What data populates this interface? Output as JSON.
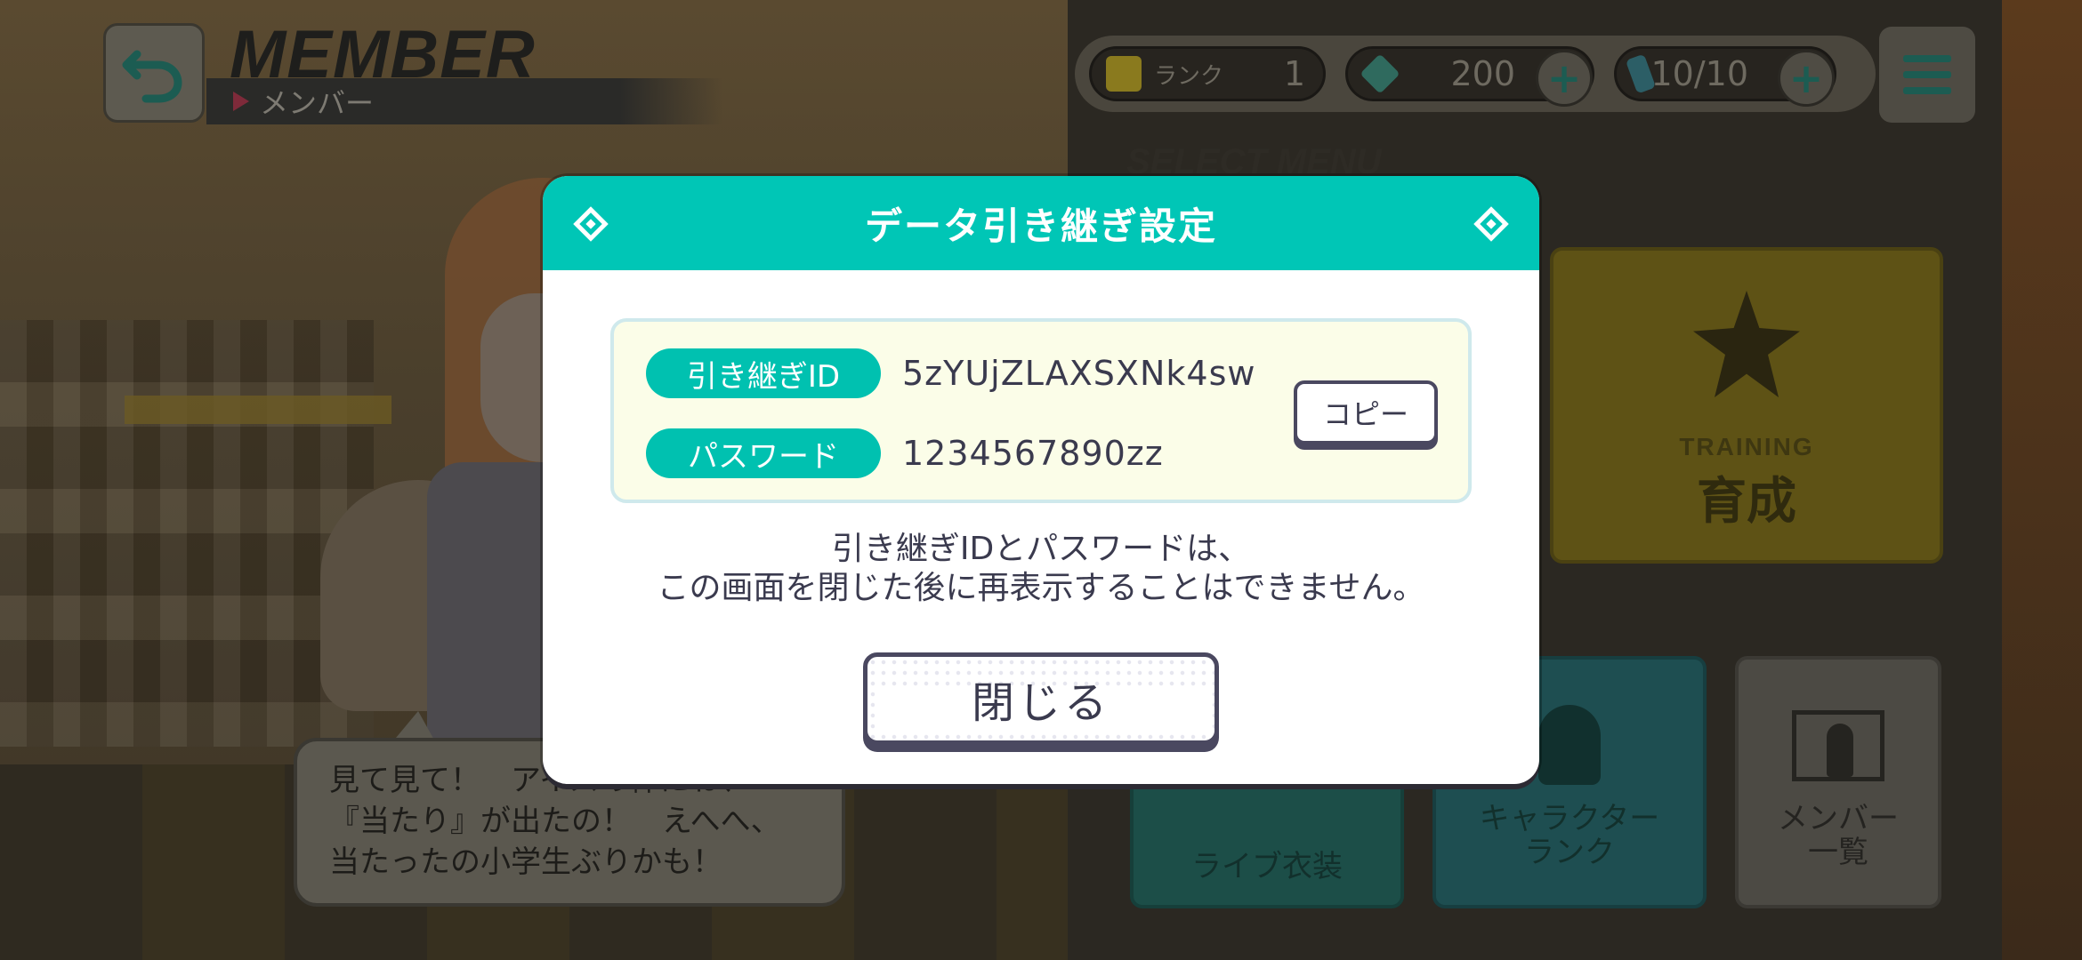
{
  "header": {
    "title": "MEMBER",
    "subtitle": "メンバー"
  },
  "status": {
    "rank_label": "ランク",
    "rank_value": "1",
    "gems": "200",
    "tickets": "10/10"
  },
  "section_label": "SELECT MENU",
  "menu_cards": {
    "training_en": "TRAINING",
    "training_jp": "育成",
    "costume": "ライブ衣装",
    "character_rank_line1": "キャラクター",
    "character_rank_line2": "ランク",
    "member_list_line1": "メンバー",
    "member_list_line2": "一覧"
  },
  "speech": {
    "line1": "見て見て！　アイスの棒にね、",
    "line2": "『当たり』が出たの！　えへへ、",
    "line3": "当たったの小学生ぶりかも！"
  },
  "dialog": {
    "title": "データ引き継ぎ設定",
    "id_label": "引き継ぎID",
    "id_value": "5zYUjZLAXSXNk4sw",
    "password_label": "パスワード",
    "password_value": "1234567890zz",
    "copy_label": "コピー",
    "notice_line1": "引き継ぎIDとパスワードは、",
    "notice_line2": "この画面を閉じた後に再表示することはできません。",
    "close_label": "閉じる"
  },
  "colors": {
    "accent": "#00c6b6",
    "tag": "#00c1b0",
    "info_bg": "#fbfde8",
    "button_border": "#4a4860"
  },
  "icons": {
    "back": "back-arrow-icon",
    "rank": "music-note-icon",
    "gem": "crystal-icon",
    "ticket": "ticket-icon",
    "plus": "plus-icon",
    "menu": "hamburger-menu-icon"
  }
}
